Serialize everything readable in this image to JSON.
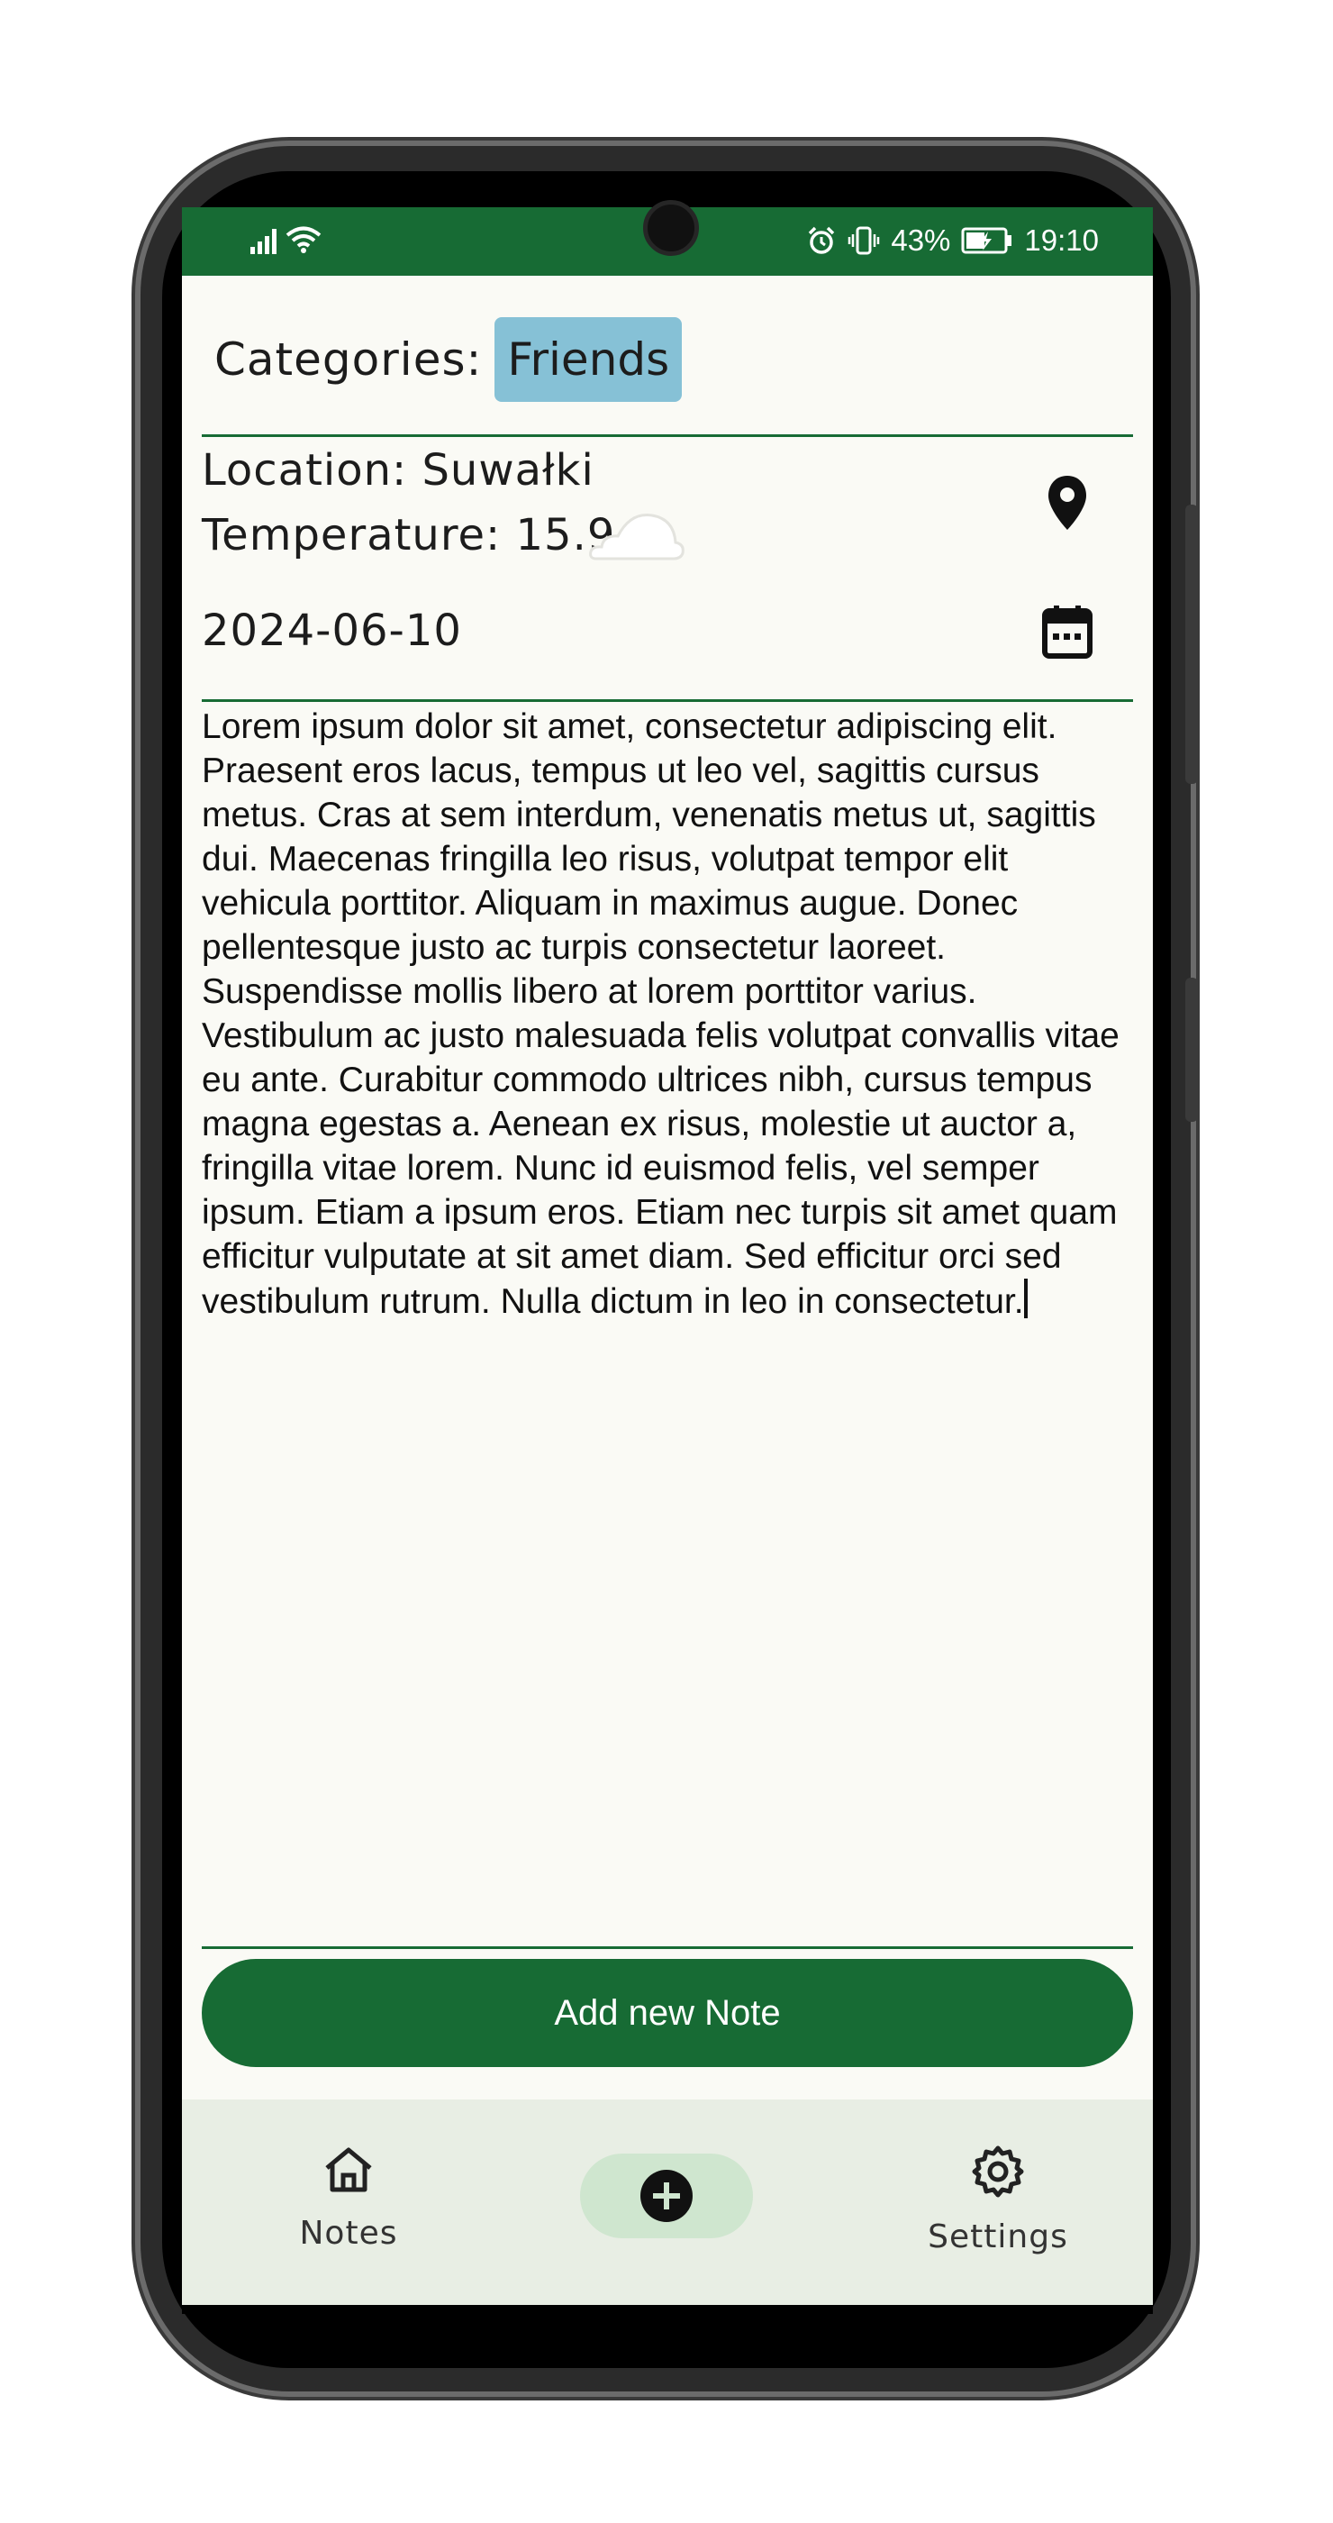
{
  "status_bar": {
    "battery_percent": "43%",
    "time": "19:10"
  },
  "categories": {
    "label": "Categories:",
    "selected_chip": "Friends"
  },
  "location": {
    "location_text": "Location: Suwałki",
    "temperature_text": "Temperature: 15.9",
    "weather_icon": "cloud-icon"
  },
  "date": {
    "value": "2024-06-10"
  },
  "note": {
    "body": "Lorem ipsum dolor sit amet, consectetur adipiscing elit. Praesent eros lacus, tempus ut leo vel, sagittis cursus metus. Cras at sem interdum, venenatis metus ut, sagittis dui. Maecenas fringilla leo risus, volutpat tempor elit vehicula porttitor. Aliquam in maximus augue. Donec pellentesque justo ac turpis consectetur laoreet. Suspendisse mollis libero at lorem porttitor varius. Vestibulum ac justo malesuada felis volutpat convallis vitae eu ante. Curabitur commodo ultrices nibh, cursus tempus magna egestas a. Aenean ex risus, molestie ut auctor a, fringilla vitae lorem. Nunc id euismod felis, vel semper ipsum. Etiam a ipsum eros. Etiam nec turpis sit amet quam efficitur vulputate at sit amet diam. Sed efficitur orci sed vestibulum rutrum. Nulla dictum in leo in consectetur."
  },
  "actions": {
    "add_button_label": "Add new Note"
  },
  "bottom_nav": {
    "items": [
      {
        "label": "Notes",
        "icon": "home-icon"
      },
      {
        "label": "",
        "icon": "add-circle-icon"
      },
      {
        "label": "Settings",
        "icon": "gear-icon"
      }
    ]
  },
  "colors": {
    "primary_green": "#176b34",
    "chip_blue": "#86c1d6",
    "nav_background": "#e8eee4",
    "fab_tint": "#cfe6cf"
  }
}
